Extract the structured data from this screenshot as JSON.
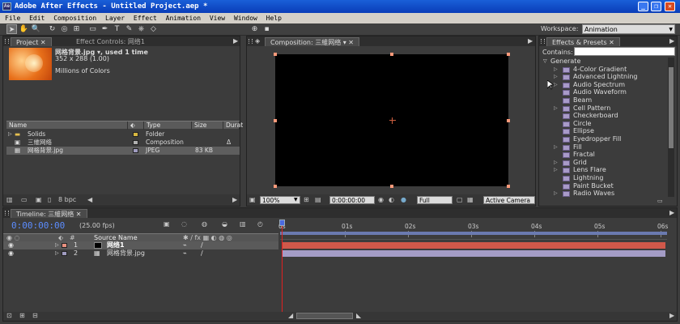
{
  "window": {
    "title": "Adobe After Effects - Untitled Project.aep *",
    "minimize_label": "_",
    "restore_label": "❐",
    "close_label": "✕"
  },
  "menu": [
    "File",
    "Edit",
    "Composition",
    "Layer",
    "Effect",
    "Animation",
    "View",
    "Window",
    "Help"
  ],
  "toolbar": {
    "workspace_label": "Workspace:",
    "workspace_value": "Animation"
  },
  "project": {
    "tab_label": "Project",
    "tab2_label": "Effect Controls: 网络1",
    "thumb_name": "网格背景.jpg ▾, used 1 time",
    "thumb_dims": "352 x 288 (1.00)",
    "thumb_colors": "Millions of Colors",
    "columns": [
      "Name",
      "Type",
      "Size",
      "Durat"
    ],
    "items": [
      {
        "name": "Solids",
        "type": "Folder",
        "size": "",
        "dur": "",
        "swatch": "#d8b840"
      },
      {
        "name": "三維网络",
        "type": "Composition",
        "size": "",
        "dur": "Δ",
        "swatch": "#b0b0b0"
      },
      {
        "name": "网格背景.jpg",
        "type": "JPEG",
        "size": "83 KB",
        "dur": "",
        "swatch": "#a09cc0"
      }
    ],
    "bpc": "8 bpc"
  },
  "composition": {
    "tab_label": "Composition: 三維网络",
    "zoom": "100%",
    "timecode": "0:00:00:00",
    "resolution": "Full",
    "view": "Active Camera"
  },
  "effects": {
    "tab_label": "Effects & Presets",
    "contains_label": "Contains:",
    "category": "Generate",
    "items": [
      {
        "label": "4-Color Gradient",
        "expand": true
      },
      {
        "label": "Advanced Lightning",
        "expand": true
      },
      {
        "label": "Audio Spectrum",
        "expand": true
      },
      {
        "label": "Audio Waveform",
        "expand": false
      },
      {
        "label": "Beam",
        "expand": false
      },
      {
        "label": "Cell Pattern",
        "expand": true
      },
      {
        "label": "Checkerboard",
        "expand": false
      },
      {
        "label": "Circle",
        "expand": false
      },
      {
        "label": "Ellipse",
        "expand": false
      },
      {
        "label": "Eyedropper Fill",
        "expand": false
      },
      {
        "label": "Fill",
        "expand": true
      },
      {
        "label": "Fractal",
        "expand": false
      },
      {
        "label": "Grid",
        "expand": true
      },
      {
        "label": "Lens Flare",
        "expand": true
      },
      {
        "label": "Lightning",
        "expand": false
      },
      {
        "label": "Paint Bucket",
        "expand": false
      },
      {
        "label": "Radio Waves",
        "expand": true
      }
    ]
  },
  "timeline": {
    "tab_label": "Timeline: 三維网络",
    "timecode": "0:00:00:00",
    "fps": "(25.00 fps)",
    "source_name_header": "Source Name",
    "ruler": [
      "0s",
      "01s",
      "02s",
      "03s",
      "04s",
      "05s",
      "06s"
    ],
    "layers": [
      {
        "num": "1",
        "name": "网络1",
        "label_color": "#e89080",
        "bar_color": "#d0584a"
      },
      {
        "num": "2",
        "name": "网格背景.jpg",
        "label_color": "#a09cc0",
        "bar_color": "#a49cc6"
      }
    ]
  },
  "colors": {
    "title_bar": "#0a3db8",
    "timecode_blue": "#5c8dff",
    "cti_red": "#e02020"
  }
}
